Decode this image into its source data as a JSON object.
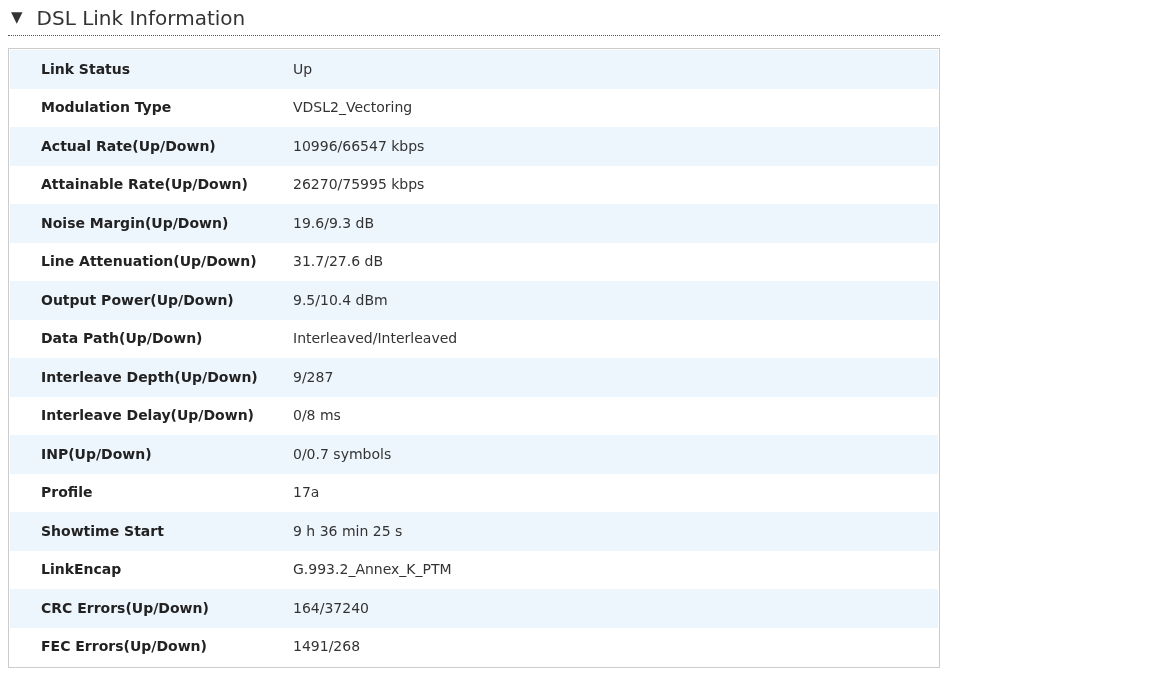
{
  "section": {
    "toggle": "▼",
    "title": "DSL Link Information"
  },
  "rows": [
    {
      "label": "Link Status",
      "value": "Up"
    },
    {
      "label": "Modulation Type",
      "value": "VDSL2_Vectoring"
    },
    {
      "label": "Actual Rate(Up/Down)",
      "value": "10996/66547 kbps"
    },
    {
      "label": "Attainable Rate(Up/Down)",
      "value": "26270/75995 kbps"
    },
    {
      "label": "Noise Margin(Up/Down)",
      "value": "19.6/9.3 dB"
    },
    {
      "label": "Line Attenuation(Up/Down)",
      "value": "31.7/27.6 dB"
    },
    {
      "label": "Output Power(Up/Down)",
      "value": "9.5/10.4 dBm"
    },
    {
      "label": "Data Path(Up/Down)",
      "value": "Interleaved/Interleaved"
    },
    {
      "label": "Interleave Depth(Up/Down)",
      "value": "9/287"
    },
    {
      "label": "Interleave Delay(Up/Down)",
      "value": "0/8 ms"
    },
    {
      "label": "INP(Up/Down)",
      "value": "0/0.7 symbols"
    },
    {
      "label": "Profile",
      "value": "17a"
    },
    {
      "label": "Showtime Start",
      "value": "9 h 36 min 25 s"
    },
    {
      "label": "LinkEncap",
      "value": "G.993.2_Annex_K_PTM"
    },
    {
      "label": "CRC Errors(Up/Down)",
      "value": "164/37240"
    },
    {
      "label": "FEC Errors(Up/Down)",
      "value": "1491/268"
    }
  ]
}
